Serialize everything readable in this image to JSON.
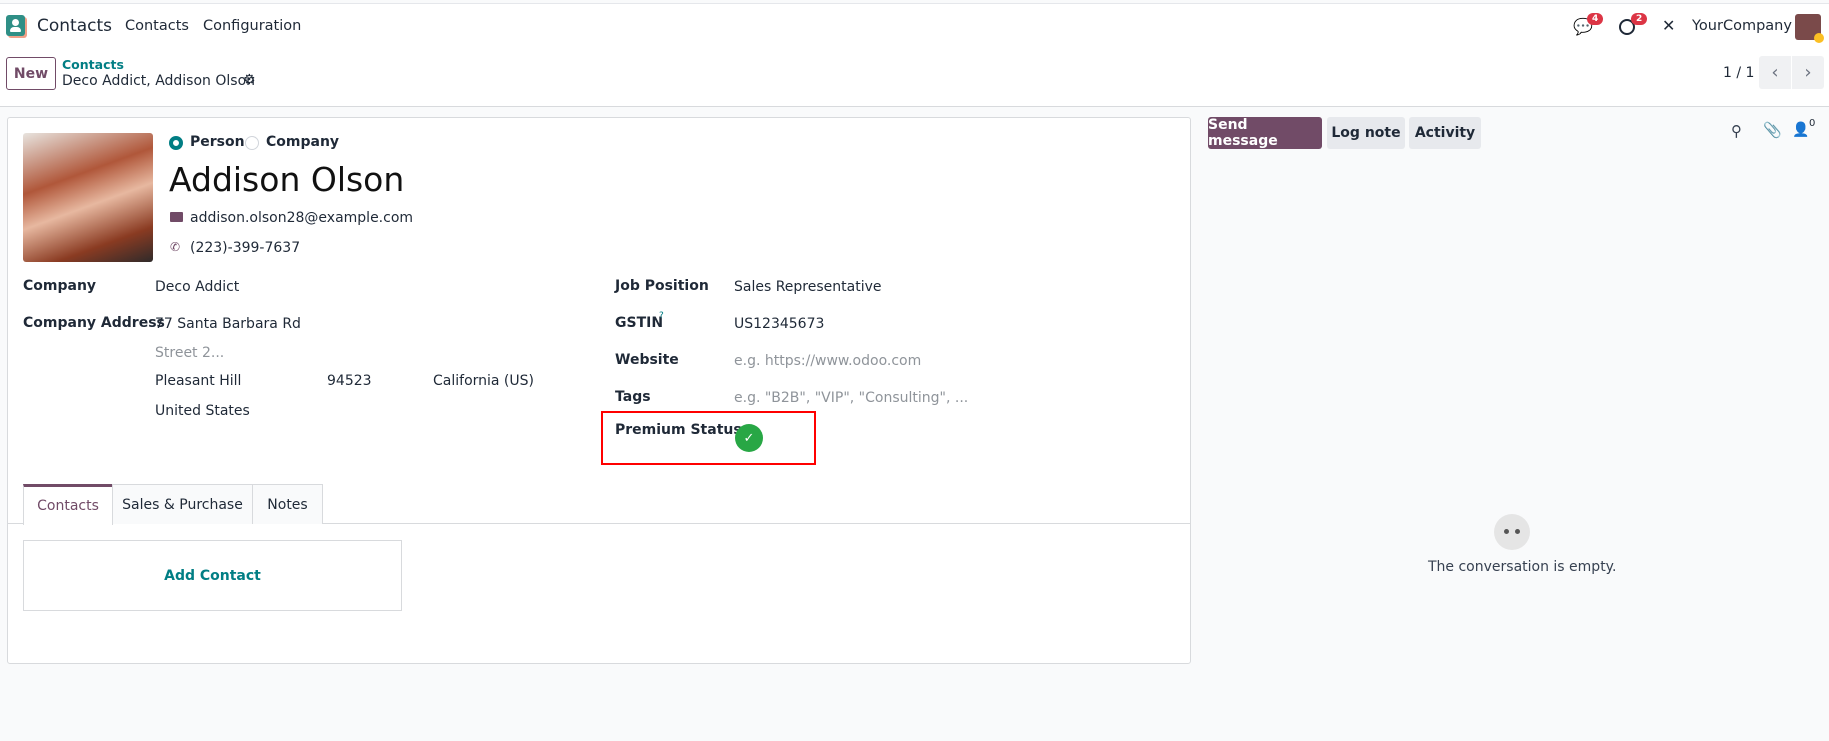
{
  "navbar": {
    "app_name": "Contacts",
    "menu": [
      "Contacts",
      "Configuration"
    ],
    "messages_count": "4",
    "activities_count": "2",
    "company": "YourCompany"
  },
  "control_panel": {
    "new_label": "New",
    "breadcrumb_parent": "Contacts",
    "breadcrumb_current": "Deco Addict, Addison Olson",
    "pager": "1 / 1"
  },
  "form": {
    "type_options": [
      "Person",
      "Company"
    ],
    "type_selected": "Person",
    "name": "Addison Olson",
    "email": "addison.olson28@example.com",
    "phone": "(223)-399-7637",
    "left_fields": {
      "company_label": "Company",
      "company_value": "Deco Addict",
      "address_label": "Company Address",
      "street": "77 Santa Barbara Rd",
      "street2_placeholder": "Street 2...",
      "city": "Pleasant Hill",
      "zip": "94523",
      "state": "California (US)",
      "country": "United States"
    },
    "right_fields": {
      "job_label": "Job Position",
      "job_value": "Sales Representative",
      "gstin_label": "GSTIN",
      "gstin_help": "?",
      "gstin_value": "US12345673",
      "website_label": "Website",
      "website_placeholder": "e.g. https://www.odoo.com",
      "tags_label": "Tags",
      "tags_placeholder": "e.g. \"B2B\", \"VIP\", \"Consulting\", ...",
      "premium_label": "Premium Status",
      "premium_value": true
    },
    "tabs": [
      "Contacts",
      "Sales & Purchase",
      "Notes"
    ],
    "active_tab": "Contacts",
    "add_contact": "Add Contact"
  },
  "chatter": {
    "send_message": "Send message",
    "log_note": "Log note",
    "activity": "Activity",
    "followers_count": "0",
    "empty_text": "The conversation is empty."
  },
  "colors": {
    "primary": "#714b67",
    "link": "#017e84",
    "success": "#28a745",
    "highlight": "#ff0000"
  }
}
